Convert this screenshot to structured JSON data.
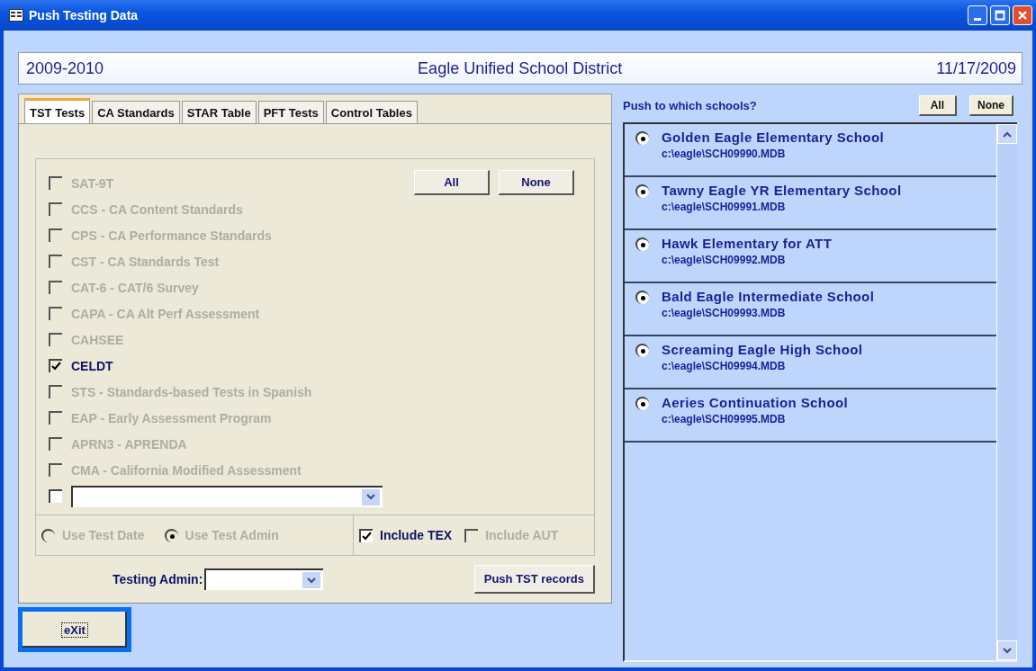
{
  "window": {
    "title": "Push Testing Data"
  },
  "header": {
    "year": "2009-2010",
    "district": "Eagle Unified School District",
    "date": "11/17/2009"
  },
  "tabs": [
    {
      "label": "TST Tests",
      "selected": true
    },
    {
      "label": "CA Standards",
      "selected": false
    },
    {
      "label": "STAR Table",
      "selected": false
    },
    {
      "label": "PFT Tests",
      "selected": false
    },
    {
      "label": "Control Tables",
      "selected": false
    }
  ],
  "test_buttons": [
    "All",
    "None"
  ],
  "tests": [
    {
      "label": "SAT-9T",
      "checked": false,
      "disabled": true
    },
    {
      "label": "CCS - CA Content Standards",
      "checked": false,
      "disabled": true
    },
    {
      "label": "CPS - CA Performance Standards",
      "checked": false,
      "disabled": true
    },
    {
      "label": "CST - CA Standards Test",
      "checked": false,
      "disabled": true
    },
    {
      "label": "CAT-6 - CAT/6 Survey",
      "checked": false,
      "disabled": true
    },
    {
      "label": "CAPA - CA Alt Perf Assessment",
      "checked": false,
      "disabled": true
    },
    {
      "label": "CAHSEE",
      "checked": false,
      "disabled": true
    },
    {
      "label": "CELDT",
      "checked": true,
      "disabled": false
    },
    {
      "label": "STS - Standards-based Tests in Spanish",
      "checked": false,
      "disabled": true
    },
    {
      "label": "EAP - Early Assessment Program",
      "checked": false,
      "disabled": true
    },
    {
      "label": "APRN3 - APRENDA",
      "checked": false,
      "disabled": true
    },
    {
      "label": "CMA - California Modified Assessment",
      "checked": false,
      "disabled": true
    }
  ],
  "other_test": {
    "checked": false
  },
  "date_options": [
    {
      "label": "Use Test Date",
      "selected": false,
      "disabled": true
    },
    {
      "label": "Use Test Admin",
      "selected": true,
      "disabled": true
    }
  ],
  "include_options": [
    {
      "label": "Include TEX",
      "checked": true,
      "disabled": false
    },
    {
      "label": "Include AUT",
      "checked": false,
      "disabled": true
    }
  ],
  "testing_admin": {
    "label": "Testing Admin:"
  },
  "push_button": "Push TST records",
  "exit_button": "eXit",
  "schools_panel": {
    "label": "Push to which schools?",
    "buttons": [
      "All",
      "None"
    ]
  },
  "schools": [
    {
      "name": "Golden Eagle Elementary School",
      "file": "c:\\eagle\\SCH09990.MDB",
      "selected": true
    },
    {
      "name": "Tawny Eagle YR Elementary School",
      "file": "c:\\eagle\\SCH09991.MDB",
      "selected": true
    },
    {
      "name": "Hawk Elementary for ATT",
      "file": "c:\\eagle\\SCH09992.MDB",
      "selected": true
    },
    {
      "name": "Bald Eagle Intermediate School",
      "file": "c:\\eagle\\SCH09993.MDB",
      "selected": true
    },
    {
      "name": "Screaming Eagle High School",
      "file": "c:\\eagle\\SCH09994.MDB",
      "selected": true
    },
    {
      "name": "Aeries Continuation School",
      "file": "c:\\eagle\\SCH09995.MDB",
      "selected": true
    }
  ]
}
